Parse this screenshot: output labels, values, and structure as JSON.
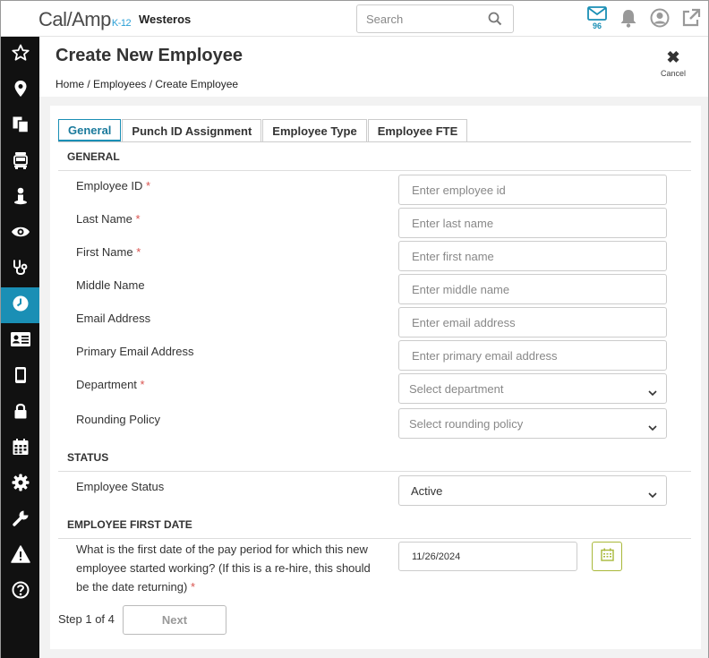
{
  "topbar": {
    "logo_text": "Cal/Amp",
    "logo_suffix": "K-12",
    "district": "Westeros",
    "search_placeholder": "Search",
    "mail_count": "96"
  },
  "sidebar": {
    "items": [
      {
        "icon": "star-icon",
        "active": false
      },
      {
        "icon": "map-pin-icon",
        "active": false
      },
      {
        "icon": "documents-icon",
        "active": false
      },
      {
        "icon": "bus-icon",
        "active": false
      },
      {
        "icon": "person-icon",
        "active": false
      },
      {
        "icon": "eye-icon",
        "active": false
      },
      {
        "icon": "stethoscope-icon",
        "active": false
      },
      {
        "icon": "clock-icon",
        "active": true
      },
      {
        "icon": "id-card-icon",
        "active": false
      },
      {
        "icon": "tablet-icon",
        "active": false
      },
      {
        "icon": "lock-icon",
        "active": false
      },
      {
        "icon": "calendar-icon",
        "active": false
      },
      {
        "icon": "gear-icon",
        "active": false
      },
      {
        "icon": "wrench-icon",
        "active": false
      },
      {
        "icon": "warning-icon",
        "active": false
      },
      {
        "icon": "help-icon",
        "active": false
      }
    ]
  },
  "page": {
    "title": "Create New Employee",
    "breadcrumb": "Home / Employees / Create Employee",
    "cancel_label": "Cancel"
  },
  "tabs": [
    "General",
    "Punch ID Assignment",
    "Employee Type",
    "Employee FTE"
  ],
  "general": {
    "section_title": "GENERAL",
    "employee_id": {
      "label": "Employee ID",
      "placeholder": "Enter employee id"
    },
    "last_name": {
      "label": "Last Name",
      "placeholder": "Enter last name"
    },
    "first_name": {
      "label": "First Name",
      "placeholder": "Enter first name"
    },
    "middle_name": {
      "label": "Middle Name",
      "placeholder": "Enter middle name"
    },
    "email": {
      "label": "Email Address",
      "placeholder": "Enter email address"
    },
    "primary_email": {
      "label": "Primary Email Address",
      "placeholder": "Enter primary email address"
    },
    "department": {
      "label": "Department",
      "placeholder": "Select department"
    },
    "rounding_policy": {
      "label": "Rounding Policy",
      "placeholder": "Select rounding policy"
    }
  },
  "status": {
    "section_title": "STATUS",
    "employee_status": {
      "label": "Employee Status",
      "value": "Active"
    }
  },
  "first_date": {
    "section_title": "EMPLOYEE FIRST DATE",
    "question": "What is the first date of the pay period for which this new employee started working? (If this is a re-hire, this should be the date returning)",
    "value": "11/26/2024"
  },
  "footer": {
    "step": "Step 1 of 4",
    "next_label": "Next"
  },
  "colors": {
    "accent": "#1a8fb5",
    "sidebar_bg": "#111111",
    "required": "#d9534f",
    "calendar_border": "#a9b83a"
  }
}
